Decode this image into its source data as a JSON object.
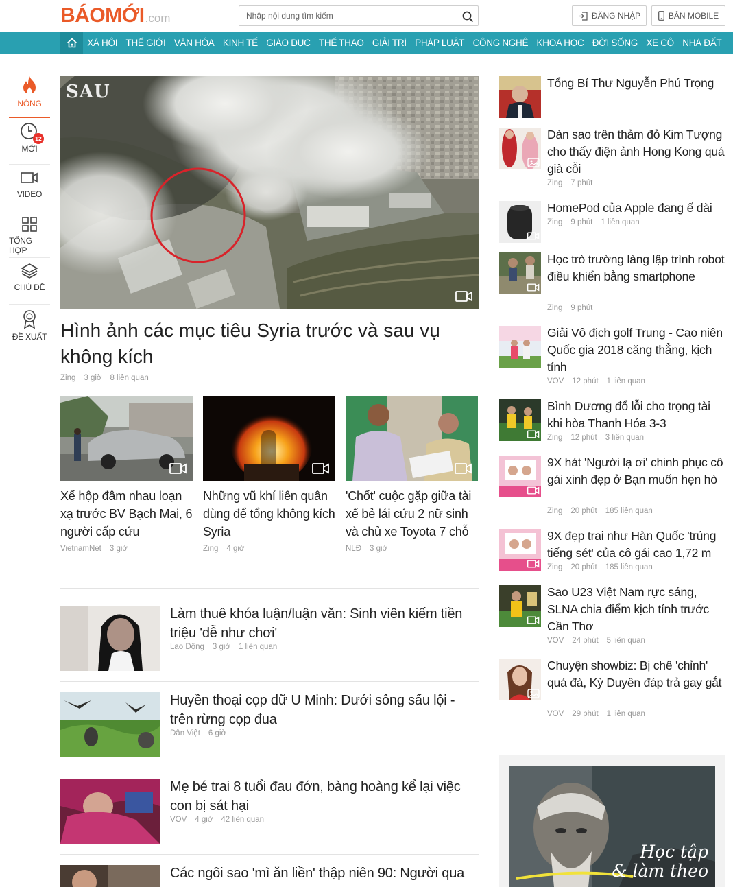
{
  "header": {
    "logo_main": "BÁOMỚI",
    "logo_suffix": ".com",
    "search_placeholder": "Nhập nội dung tìm kiếm",
    "login_label": "ĐĂNG NHẬP",
    "mobile_label": "BẢN MOBILE"
  },
  "nav": {
    "items": [
      "XÃ HỘI",
      "THẾ GIỚI",
      "VĂN HÓA",
      "KINH TẾ",
      "GIÁO DỤC",
      "THỂ THAO",
      "GIẢI TRÍ",
      "PHÁP LUẬT",
      "CÔNG NGHỆ",
      "KHOA HỌC",
      "ĐỜI SỐNG",
      "XE CỘ",
      "NHÀ ĐẤT"
    ]
  },
  "rail": {
    "items": [
      {
        "label": "NÓNG",
        "icon": "flame-icon"
      },
      {
        "label": "MỚI",
        "icon": "clock-icon",
        "badge": "12"
      },
      {
        "label": "VIDEO",
        "icon": "video-icon"
      },
      {
        "label": "TỔNG HỢP",
        "icon": "grid-icon"
      },
      {
        "label": "CHỦ ĐỀ",
        "icon": "layers-icon"
      },
      {
        "label": "ĐỀ XUẤT",
        "icon": "award-icon"
      }
    ]
  },
  "hero": {
    "image_label": "SAU",
    "title": "Hình ảnh các mục tiêu Syria trước và sau vụ không kích",
    "source": "Zing",
    "time": "3 giờ",
    "related": "8 liên quan"
  },
  "cards": [
    {
      "title": "Xế hộp đâm nhau loạn xạ trước BV Bạch Mai, 6 người cấp cứu",
      "source": "VietnamNet",
      "time": "3 giờ"
    },
    {
      "title": "Những vũ khí liên quân dùng để tổng không kích Syria",
      "source": "Zing",
      "time": "4 giờ"
    },
    {
      "title": "'Chốt' cuộc gặp giữa tài xế bẻ lái cứu 2 nữ sinh và chủ xe Toyota 7 chỗ",
      "source": "NLĐ",
      "time": "3 giờ"
    }
  ],
  "list": [
    {
      "title": "Làm thuê khóa luận/luận văn: Sinh viên kiếm tiền triệu 'dễ như chơi'",
      "source": "Lao Động",
      "time": "3 giờ",
      "related": "1 liên quan"
    },
    {
      "title": "Huyền thoại cọp dữ U Minh: Dưới sông sấu lội - trên rừng cọp đua",
      "source": "Dân Việt",
      "time": "6 giờ",
      "related": ""
    },
    {
      "title": "Mẹ bé trai 8 tuổi đau đớn, bàng hoàng kể lại việc con bị sát hại",
      "source": "VOV",
      "time": "4 giờ",
      "related": "42 liên quan"
    },
    {
      "title": "Các ngôi sao 'mì ăn liền' thập niên 90: Người qua",
      "source": "",
      "time": "",
      "related": ""
    }
  ],
  "sidebar": [
    {
      "title": "Tổng Bí Thư Nguyễn Phú Trọng",
      "source": "",
      "time": "",
      "related": ""
    },
    {
      "title": "Dàn sao trên thảm đỏ Kim Tượng cho thấy điện ảnh Hong Kong quá già cỗi",
      "source": "Zing",
      "time": "7 phút",
      "related": ""
    },
    {
      "title": "HomePod của Apple đang ế dài",
      "source": "Zing",
      "time": "9 phút",
      "related": "1 liên quan"
    },
    {
      "title": "Học trò trường làng lập trình robot điều khiển bằng smartphone",
      "source": "Zing",
      "time": "9 phút",
      "related": ""
    },
    {
      "title": "Giải Vô địch golf Trung - Cao niên Quốc gia 2018 căng thẳng, kịch tính",
      "source": "VOV",
      "time": "12 phút",
      "related": "1 liên quan"
    },
    {
      "title": "Bình Dương đổ lỗi cho trọng tài khi hòa Thanh Hóa 3-3",
      "source": "Zing",
      "time": "12 phút",
      "related": "3 liên quan"
    },
    {
      "title": "9X hát 'Người lạ ơi' chinh phục cô gái xinh đẹp ở Bạn muốn hẹn hò",
      "source": "Zing",
      "time": "20 phút",
      "related": "185 liên quan"
    },
    {
      "title": "9X đẹp trai như Hàn Quốc 'trúng tiếng sét' của cô gái cao 1,72 m",
      "source": "Zing",
      "time": "20 phút",
      "related": "185 liên quan"
    },
    {
      "title": "Sao U23 Việt Nam rực sáng, SLNA chia điểm kịch tính trước Cần Thơ",
      "source": "VOV",
      "time": "24 phút",
      "related": "5 liên quan"
    },
    {
      "title": "Chuyện showbiz: Bị chê 'chỉnh' quá đà, Kỳ Duyên đáp trả gay gắt",
      "source": "VOV",
      "time": "29 phút",
      "related": "1 liên quan"
    }
  ],
  "promo": {
    "line1": "Học tập",
    "line2": "& làm theo"
  },
  "colors": {
    "brand": "#ea5a28",
    "nav": "#29a0b1",
    "nav_home": "#1e8b9a",
    "badge": "#e8312b"
  }
}
